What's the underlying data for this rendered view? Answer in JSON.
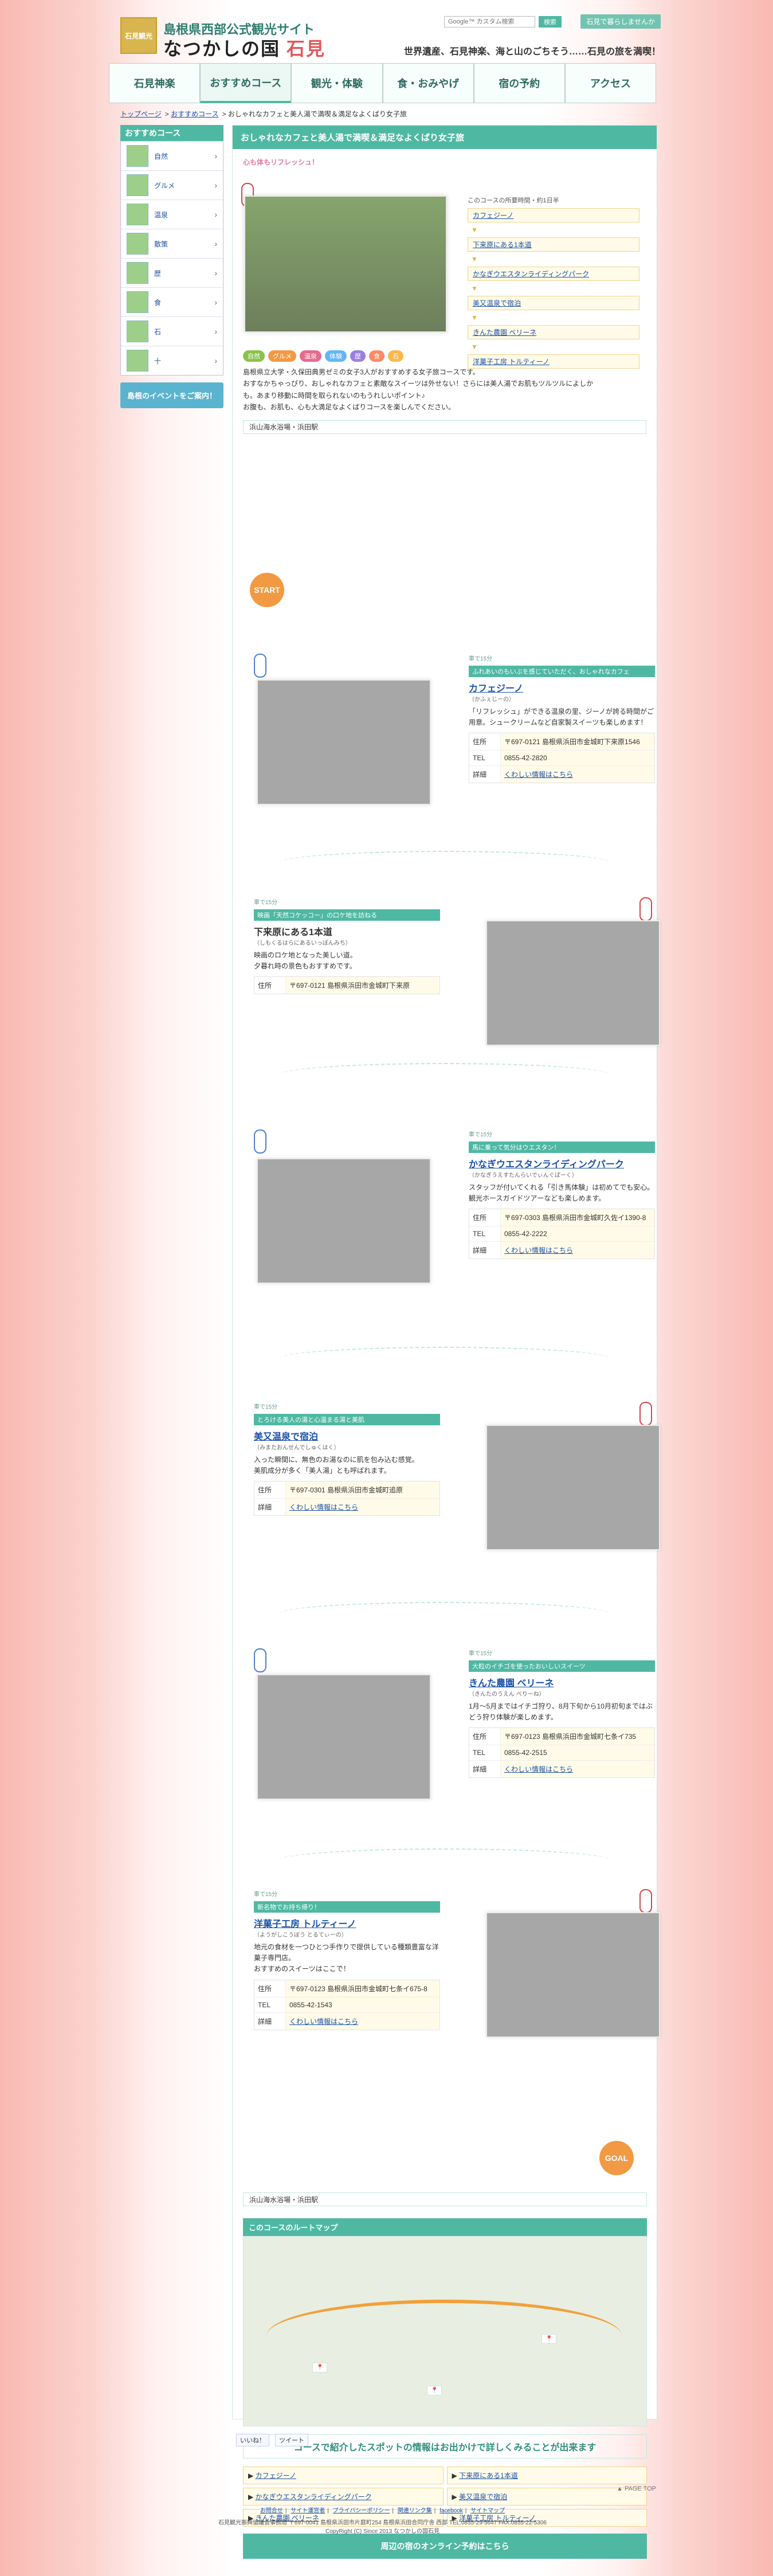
{
  "header": {
    "logo_text": "石見観光",
    "site_label": "島根県西部公式観光サイト",
    "site_name_prefix": "なつかしの国",
    "site_name_accent": "石見",
    "search_placeholder": "Google™ カスタム検索",
    "search_button": "検索",
    "top_link": "石見で暮らしませんか",
    "tagline": "世界遺産、石見神楽、海と山のごちそう……石見の旅を満喫！"
  },
  "nav": [
    {
      "label": "石見神楽"
    },
    {
      "label": "おすすめコース"
    },
    {
      "label": "観光・体験"
    },
    {
      "label": "食・おみやげ"
    },
    {
      "label": "宿の予約"
    },
    {
      "label": "アクセス"
    }
  ],
  "breadcrumb": [
    "トップページ",
    "おすすめコース",
    "おしゃれなカフェと美人湯で満喫＆満足なよくばり女子旅"
  ],
  "sidebar": {
    "title": "おすすめコース",
    "items": [
      {
        "label": "自然"
      },
      {
        "label": "グルメ"
      },
      {
        "label": "温泉"
      },
      {
        "label": "散策"
      },
      {
        "label": "歴"
      },
      {
        "label": "食"
      },
      {
        "label": "石"
      },
      {
        "label": "十"
      }
    ],
    "banner": "島根のイベントをご案内！"
  },
  "main": {
    "title": "おしゃれなカフェと美人湯で満喫＆満足なよくばり女子旅",
    "lead_sub": "心も体もリフレッシュ！",
    "route_box_title": "このコースの所要時間・約1日半",
    "route_items": [
      "カフェジーノ",
      "下来原にある1本道",
      "かなぎウエスタンライディングパーク",
      "美又温泉で宿泊",
      "きんた農園 ベリーネ",
      "洋菓子工房 トルティーノ"
    ],
    "tags": [
      {
        "label": "自然",
        "color": "#8bc34a"
      },
      {
        "label": "グルメ",
        "color": "#f29a43"
      },
      {
        "label": "温泉",
        "color": "#e86a8a"
      },
      {
        "label": "体験",
        "color": "#64b5f6"
      },
      {
        "label": "歴",
        "color": "#9c7fdc"
      },
      {
        "label": "食",
        "color": "#ff8a65"
      },
      {
        "label": "石",
        "color": "#ffb74d"
      }
    ],
    "description": "島根県立大学・久保田典男ゼミの女子3人がおすすめする女子旅コースです。\nおすなかちゃっぴり、おしゃれなカフェと素敵なスイーツは外せない！さらには美人湯でお肌もツルツルによしか\nも。あまり移動に時間を取られないのもうれしいポイント♪\nお腹も、お肌も、心も大満足なよくばりコースを楽しんでください。",
    "start_label": "浜山海水浴場・浜田駅",
    "start_badge": "START"
  },
  "spots": [
    {
      "walk": "車で15分",
      "head": "ふれあいのもいぶを感じていただく、おしゃれなカフェ",
      "name": "カフェジーノ",
      "kana": "（かふぇじーの）",
      "text": "「リフレッシュ」ができる温泉の里、ジーノが誇る時間がご用意。シュークリームなど自家製スイーツも楽しめます！",
      "address": "〒697-0121 島根県浜田市金城町下来原1546",
      "tel": "0855-42-2820",
      "link": "くわしい情報はこちら"
    },
    {
      "walk": "車で15分",
      "head": "映画「天然コケッコー」の口ケ地を訪ねる",
      "name": "下来原にある1本道",
      "kana": "（しもくるはらにあるいっぽんみち）",
      "text": "映画のロケ地となった美しい道。\n夕暮れ時の景色もおすすめです。",
      "address": "〒697-0121 島根県浜田市金城町下来原",
      "tel": "",
      "link": ""
    },
    {
      "walk": "車で15分",
      "head": "馬に乗って気分はウエスタン！",
      "name": "かなぎウエスタンライディングパーク",
      "kana": "（かなぎうえすたんらいでぃんぐぱーく）",
      "text": "スタッフが付いてくれる「引き馬体験」は初めてでも安心。\n観光ホースガイドツアーなども楽しめます。",
      "address": "〒697-0303 島根県浜田市金城町久佐イ1390-8",
      "tel": "0855-42-2222",
      "link": "くわしい情報はこちら"
    },
    {
      "walk": "車で15分",
      "head": "とろける美人の湯と心温まる湯と美肌",
      "name": "美又温泉で宿泊",
      "kana": "（みまたおんせんでしゅくはく）",
      "text": "入った瞬間に、無色のお湯なのに肌を包み込む感覚。\n美肌成分が多く「美人湯」とも呼ばれます。",
      "address": "〒697-0301 島根県浜田市金城町追原",
      "tel": "",
      "link": "くわしい情報はこちら"
    },
    {
      "walk": "車で15分",
      "head": "大粒のイチゴを使ったおいしいスイーツ",
      "name": "きんた農園 ベリーネ",
      "kana": "（きんたのうえん べりーね）",
      "text": "1月〜5月まではイチゴ狩り、8月下旬から10月初旬まではぶどう狩り体験が楽しめます。",
      "address": "〒697-0123 島根県浜田市金城町七条イ735",
      "tel": "0855-42-2515",
      "link": "くわしい情報はこちら"
    },
    {
      "walk": "車で15分",
      "head": "新名物でお持ち帰り！",
      "name": "洋菓子工房 トルティーノ",
      "kana": "（ようがしこうぼう とるてぃーの）",
      "text": "地元の食材を一つひとつ手作りで提供している種類豊富な洋菓子専門店。\nおすすめのスイーツはここで！",
      "address": "〒697-0123 島根県浜田市金城町七条イ675-8",
      "tel": "0855-42-1543",
      "link": "くわしい情報はこちら"
    }
  ],
  "goal": {
    "badge": "GOAL",
    "label": "浜山海水浴場・浜田駅"
  },
  "map": {
    "title": "このコースのルートマップ",
    "note": "コースで紹介したスポットの情報はお出かけで詳しくみることが出来ます",
    "links": [
      "カフェジーノ",
      "下来原にある1本道",
      "かなぎウエスタンライディングパーク",
      "美又温泉で宿泊",
      "きんた農園 ベリーネ",
      "洋菓子工房 トルティーノ"
    ],
    "booking": "周辺の宿のオンライン予約はこちら"
  },
  "share": {
    "like": "いいね！",
    "tweet": "ツイート"
  },
  "footer": {
    "page_top": "PAGE TOP",
    "links": [
      "お問合せ",
      "サイト運営者",
      "プライバシーポリシー",
      "関連リンク集",
      "facebook",
      "サイトマップ"
    ],
    "address": "石見観光振興協議会事務局 〒697-0041 島根県浜田市片庭町254 島根県浜田合同庁舎 西部 TEL.0855-29-5647 FAX.0855-22-5306",
    "copyright": "CopyRight (C) Since 2013 なつかしの国石見"
  }
}
